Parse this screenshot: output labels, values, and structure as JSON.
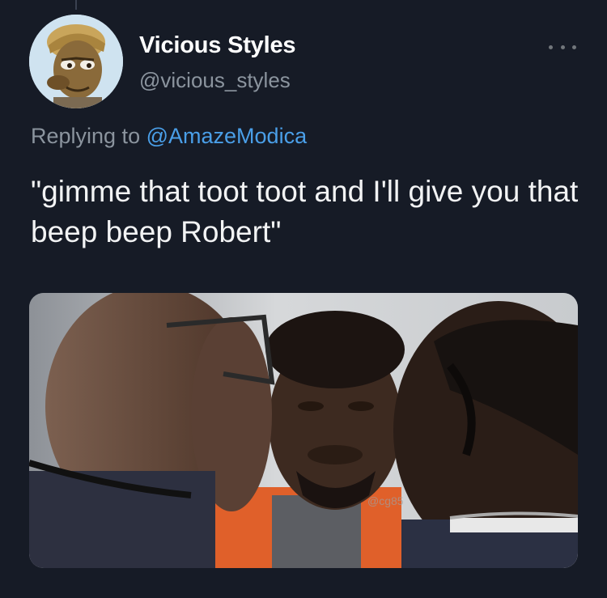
{
  "author": {
    "display_name": "Vicious Styles",
    "handle": "@vicious_styles",
    "avatar_icon": "cartoon-avatar"
  },
  "reply": {
    "prefix": "Replying to",
    "mention": "@AmazeModica"
  },
  "tweet": {
    "text": "\"gimme that toot toot and I'll give you that beep beep Robert\""
  },
  "media": {
    "watermark": "@cg85"
  },
  "colors": {
    "background": "#161b26",
    "mention_link": "#4a9fe8",
    "secondary_text": "#8b949e"
  }
}
